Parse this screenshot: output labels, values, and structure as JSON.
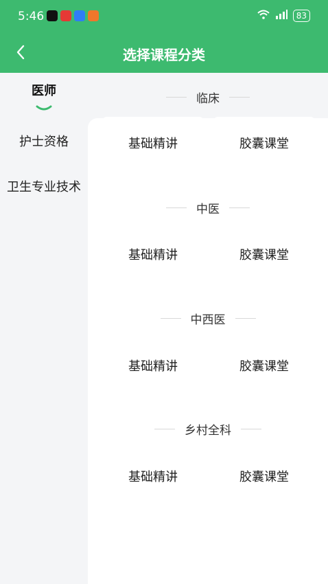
{
  "status_bar": {
    "time": "5:46",
    "battery": "83"
  },
  "header": {
    "title": "选择课程分类"
  },
  "sidebar": {
    "items": [
      {
        "label": "医师"
      },
      {
        "label": "护士资格"
      },
      {
        "label": "卫生专业技术"
      }
    ]
  },
  "sections": [
    {
      "title": "临床",
      "cards": [
        "基础精讲",
        "胶囊课堂"
      ]
    },
    {
      "title": "中医",
      "cards": [
        "基础精讲",
        "胶囊课堂"
      ]
    },
    {
      "title": "中西医",
      "cards": [
        "基础精讲",
        "胶囊课堂"
      ]
    },
    {
      "title": "乡村全科",
      "cards": [
        "基础精讲",
        "胶囊课堂"
      ]
    }
  ],
  "colors": {
    "accent": "#3dba6f",
    "background": "#f4f5f7"
  },
  "icons": {
    "back": "chevron-left-icon"
  }
}
